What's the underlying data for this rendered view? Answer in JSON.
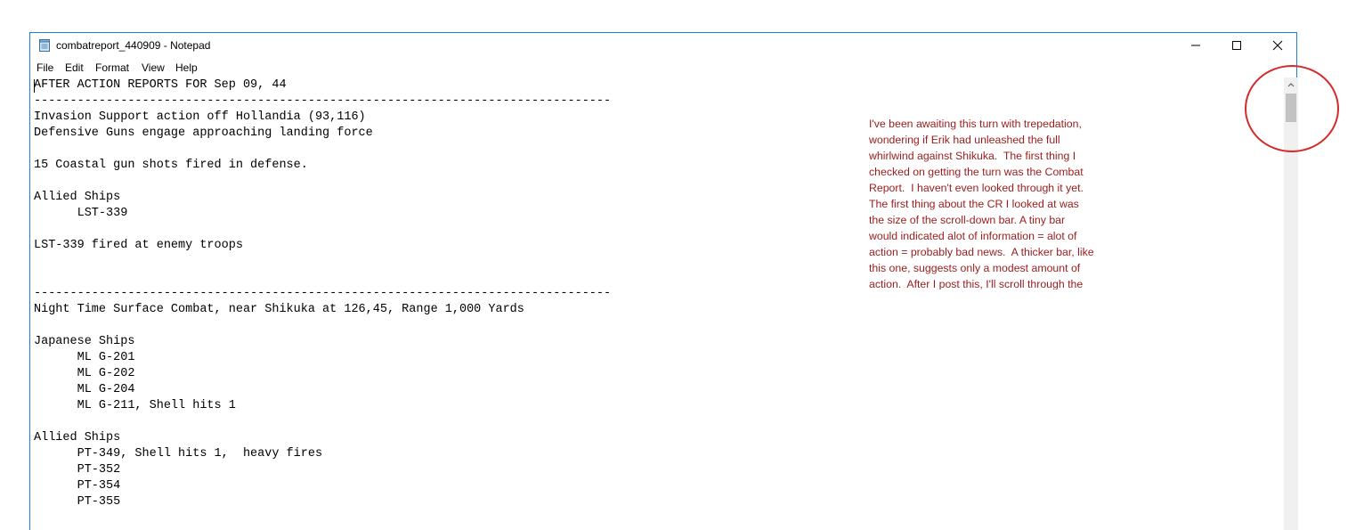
{
  "window": {
    "title": "combatreport_440909 - Notepad"
  },
  "menu": {
    "items": [
      "File",
      "Edit",
      "Format",
      "View",
      "Help"
    ]
  },
  "document": {
    "text": "AFTER ACTION REPORTS FOR Sep 09, 44\n--------------------------------------------------------------------------------\nInvasion Support action off Hollandia (93,116)\nDefensive Guns engage approaching landing force\n\n15 Coastal gun shots fired in defense.\n\nAllied Ships\n      LST-339\n\nLST-339 fired at enemy troops\n\n\n--------------------------------------------------------------------------------\nNight Time Surface Combat, near Shikuka at 126,45, Range 1,000 Yards\n\nJapanese Ships\n      ML G-201\n      ML G-202\n      ML G-204\n      ML G-211, Shell hits 1\n\nAllied Ships\n      PT-349, Shell hits 1,  heavy fires\n      PT-352\n      PT-354\n      PT-355"
  },
  "annotation": {
    "text": "I've been awaiting this turn with trepedation,\nwondering if Erik had unleashed the full\nwhirlwind against Shikuka.  The first thing I\nchecked on getting the turn was the Combat\nReport.  I haven't even looked through it yet.\nThe first thing about the CR I looked at was\nthe size of the scroll-down bar. A tiny bar\nwould indicated alot of information = alot of\naction = probably bad news.  A thicker bar, like\nthis one, suggests only a modest amount of\naction.  After I post this, I'll scroll through the",
    "color": "#9b1b1b",
    "highlight_color": "#d42a2a"
  },
  "icons": {
    "app": "notepad-icon",
    "minimize": "minimize-icon",
    "maximize": "maximize-icon",
    "close": "close-icon",
    "scroll_up": "chevron-up-icon"
  }
}
